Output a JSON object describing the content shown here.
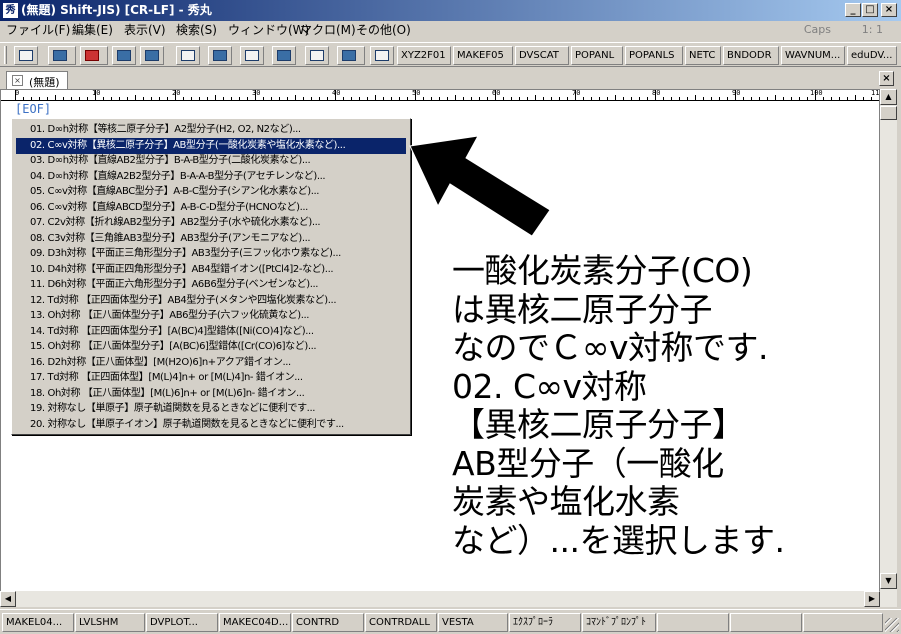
{
  "window": {
    "icon_glyph": "秀",
    "title": "(無題) Shift-JIS) [CR-LF] - 秀丸",
    "minimize": "_",
    "maximize": "□",
    "close": "×"
  },
  "menu": {
    "items": [
      "ファイル(F)",
      "編集(E)",
      "表示(V)",
      "検索(S)",
      "ウィンドウ(W)",
      "マクロ(M)",
      "その他(O)"
    ],
    "caps": "Caps",
    "position": "1: 1"
  },
  "toolbar": {
    "macros": [
      "XYZ2F01",
      "MAKEF05",
      "DVSCAT",
      "POPANL",
      "POPANLS",
      "NETC",
      "BNDODR",
      "WAVNUM...",
      "eduDV..."
    ]
  },
  "tab": {
    "close": "×",
    "label": "(無題)",
    "pane_close": "×"
  },
  "editor": {
    "ruler_numbers": [
      "0",
      "10",
      "20",
      "30",
      "40",
      "50",
      "60",
      "70",
      "80",
      "90",
      "100",
      "11"
    ],
    "eof": "[EOF]"
  },
  "popup": {
    "selected_index": 1,
    "items": [
      "01. D∞h対称【等核二原子分子】A2型分子(H2, O2, N2など)...",
      "02. C∞v対称【異核二原子分子】AB型分子(一酸化炭素や塩化水素など)...",
      "03. D∞h対称【直線AB2型分子】B-A-B型分子(二酸化炭素など)...",
      "04. D∞h対称【直線A2B2型分子】B-A-A-B型分子(アセチレンなど)...",
      "05. C∞v対称【直線ABC型分子】A-B-C型分子(シアン化水素など)...",
      "06. C∞v対称【直線ABCD型分子】A-B-C-D型分子(HCNOなど)...",
      "07. C2v対称【折れ線AB2型分子】AB2型分子(水や硫化水素など)...",
      "08. C3v対称【三角錐AB3型分子】AB3型分子(アンモニアなど)...",
      "09. D3h対称【平面正三角形型分子】AB3型分子(三フッ化ホウ素など)...",
      "10. D4h対称【平面正四角形型分子】AB4型錯イオン([PtCl4]2-など)...",
      "11. D6h対称【平面正六角形型分子】A6B6型分子(ベンゼンなど)...",
      "12. Td対称 【正四面体型分子】AB4型分子(メタンや四塩化炭素など)...",
      "13. Oh対称 【正八面体型分子】AB6型分子(六フッ化硫黄など)...",
      "14. Td対称 【正四面体型分子】[A(BC)4]型錯体([Ni(CO)4]など)...",
      "15. Oh対称 【正八面体型分子】[A(BC)6]型錯体([Cr(CO)6]など)...",
      "16. D2h対称【正八面体型】[M(H2O)6]n+アクア錯イオン...",
      "17. Td対称 【正四面体型】[M(L)4]n+ or [M(L)4]n- 錯イオン...",
      "18. Oh対称 【正八面体型】[M(L)6]n+ or [M(L)6]n- 錯イオン...",
      "19. 対称なし【単原子】原子軌道関数を見るときなどに便利です...",
      "20. 対称なし【単原子イオン】原子軌道関数を見るときなどに便利です..."
    ]
  },
  "annotation": {
    "lines": [
      "一酸化炭素分子(CO)",
      "は異核二原子分子",
      "なのでＣ∞v対称です.",
      "02. C∞v対称",
      "【異核二原子分子】",
      "AB型分子（一酸化",
      "炭素や塩化水素",
      "など）...を選択します."
    ]
  },
  "scroll": {
    "up": "▲",
    "down": "▼",
    "left": "◀",
    "right": "▶"
  },
  "bottombar": {
    "macros": [
      "MAKEL04...",
      "LVLSHM",
      "DVPLOT...",
      "MAKEC04D...",
      "CONTRD",
      "CONTRDALL",
      "VESTA",
      "ｴｸｽﾌﾟﾛｰﾗ",
      "ｺﾏﾝﾄﾞﾌﾟﾛﾝﾌﾟﾄ"
    ]
  }
}
